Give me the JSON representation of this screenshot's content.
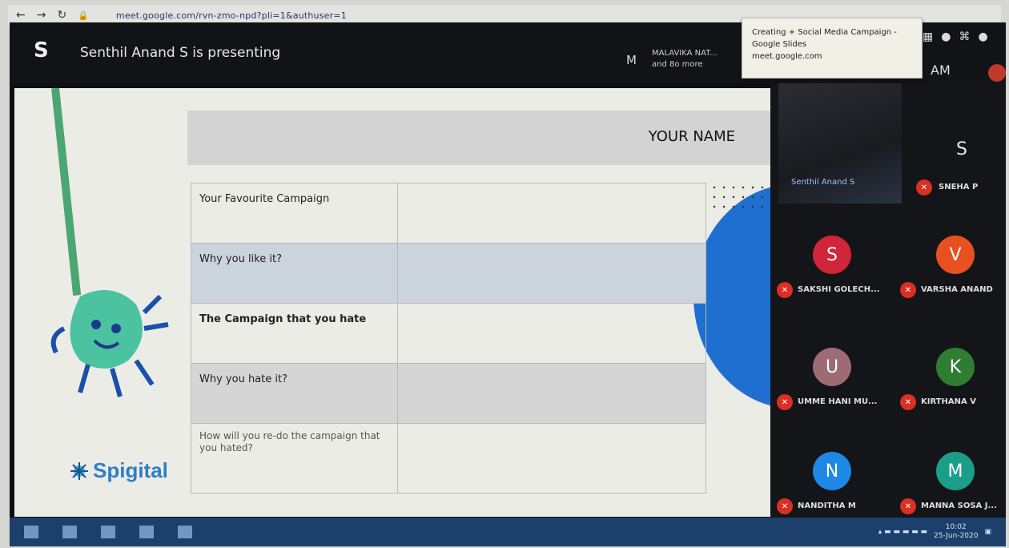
{
  "browser": {
    "url": "meet.google.com/rvn-zmo-npd?pli=1&authuser=1"
  },
  "meet": {
    "presenter_initial": "S",
    "presenting_text": "Senthil Anand S is presenting",
    "participant_initial": "M",
    "participant_names_line1": "MALAVIKA NAT...",
    "participant_names_line2": "and 8o more",
    "clock": "AM"
  },
  "tooltip": {
    "line1": "Creating + Social Media Campaign -",
    "line2": "Google Slides",
    "line3": "meet.google.com"
  },
  "slide": {
    "name_field": "YOUR NAME",
    "rows": [
      {
        "label": "Your Favourite Campaign",
        "value": ""
      },
      {
        "label": "Why you like it?",
        "value": ""
      },
      {
        "label": "The Campaign that you hate",
        "value": ""
      },
      {
        "label": "Why you hate it?",
        "value": ""
      },
      {
        "label": "How will you re-do the campaign that you hated?",
        "value": ""
      }
    ],
    "logo_text": "Spigital"
  },
  "participants": {
    "self_label": "Senthil Anand S",
    "top_right_initial": "S",
    "top_right_name": "SNEHA P",
    "tiles": [
      {
        "initial": "S",
        "name": "SAKSHI GOLECH...",
        "color": "#d0263b"
      },
      {
        "initial": "V",
        "name": "VARSHA ANAND",
        "color": "#e8501f"
      },
      {
        "initial": "U",
        "name": "UMME HANI MU...",
        "color": "#9c6b73"
      },
      {
        "initial": "K",
        "name": "KIRTHANA V",
        "color": "#2e7d32"
      },
      {
        "initial": "N",
        "name": "NANDITHA M",
        "color": "#1e88e5"
      },
      {
        "initial": "M",
        "name": "MANNA SOSA J...",
        "color": "#1a9e8a"
      }
    ]
  },
  "taskbar": {
    "time": "10:02",
    "date": "25-Jun-2020"
  }
}
